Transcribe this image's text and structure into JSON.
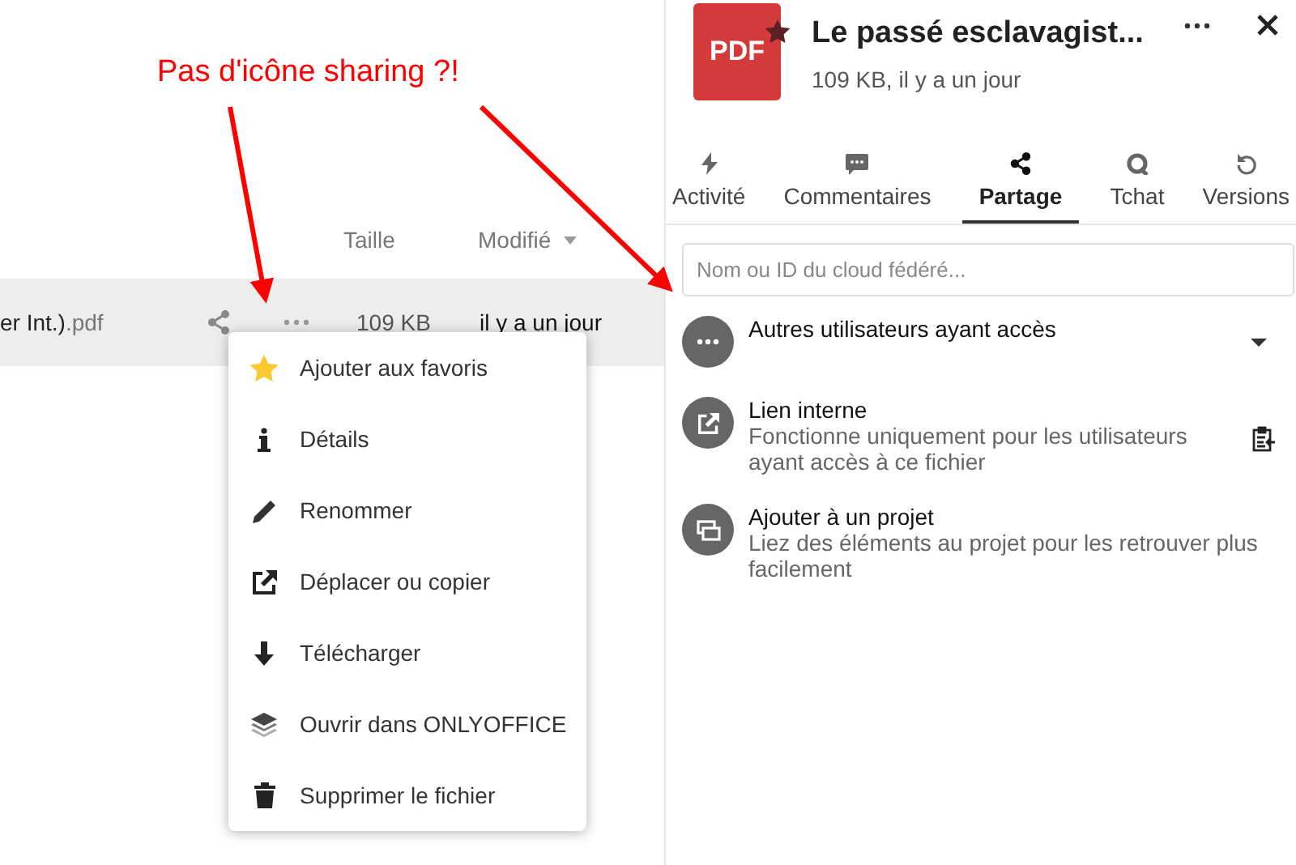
{
  "annotation": {
    "text": "Pas d'icône sharing ?!"
  },
  "file_list": {
    "columns": [
      {
        "label": "Taille",
        "sorted": false
      },
      {
        "label": "Modifié",
        "sorted": true
      }
    ],
    "rows": [
      {
        "name": "er Int.)",
        "extension": ".pdf",
        "size": "109 KB",
        "modified": "il y a un jour",
        "selected": true
      }
    ]
  },
  "context_menu": {
    "items": [
      {
        "label": "Ajouter aux favoris"
      },
      {
        "label": "Détails"
      },
      {
        "label": "Renommer"
      },
      {
        "label": "Déplacer ou copier"
      },
      {
        "label": "Télécharger"
      },
      {
        "label": "Ouvrir dans ONLYOFFICE"
      },
      {
        "label": "Supprimer le fichier"
      }
    ]
  },
  "sidebar": {
    "file_type": "PDF",
    "favorite": true,
    "title": "Le passé esclavagist...",
    "subtitle": "109 KB, il y a un jour",
    "tabs": [
      {
        "label": "Activité",
        "selected": false
      },
      {
        "label": "Commentaires",
        "selected": false
      },
      {
        "label": "Partage",
        "selected": true
      },
      {
        "label": "Tchat",
        "selected": false
      },
      {
        "label": "Versions",
        "selected": false
      }
    ],
    "search": {
      "placeholder": "Nom ou ID du cloud fédéré..."
    },
    "entries": [
      {
        "kind": "others",
        "title": "Autres utilisateurs ayant accès",
        "expanded": false
      },
      {
        "kind": "link",
        "title": "Lien interne",
        "description": "Fonctionne uniquement pour les utilisateurs ayant accès à ce fichier"
      },
      {
        "kind": "project",
        "title": "Ajouter à un projet",
        "description": "Liez des éléments au projet pour les retrouver plus facilement"
      }
    ]
  }
}
